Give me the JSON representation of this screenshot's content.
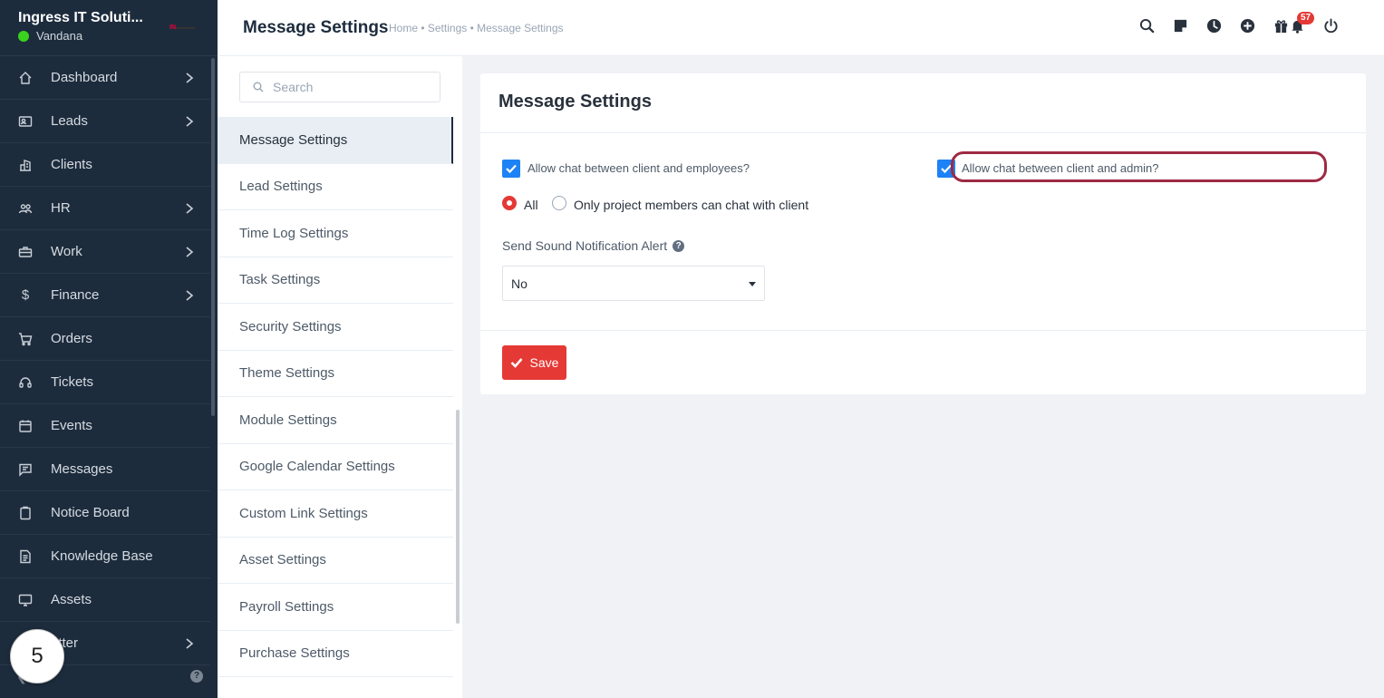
{
  "sidebar": {
    "company": "Ingress IT Soluti...",
    "user": "Vandana",
    "logo_text": "IN",
    "items": [
      {
        "label": "Dashboard",
        "icon": "home-icon",
        "has_submenu": true
      },
      {
        "label": "Leads",
        "icon": "id-card-icon",
        "has_submenu": true
      },
      {
        "label": "Clients",
        "icon": "building-icon",
        "has_submenu": false
      },
      {
        "label": "HR",
        "icon": "people-icon",
        "has_submenu": true
      },
      {
        "label": "Work",
        "icon": "briefcase-icon",
        "has_submenu": true
      },
      {
        "label": "Finance",
        "icon": "dollar-icon",
        "has_submenu": true
      },
      {
        "label": "Orders",
        "icon": "cart-icon",
        "has_submenu": false
      },
      {
        "label": "Tickets",
        "icon": "headset-icon",
        "has_submenu": false
      },
      {
        "label": "Events",
        "icon": "calendar-icon",
        "has_submenu": false
      },
      {
        "label": "Messages",
        "icon": "chat-icon",
        "has_submenu": false
      },
      {
        "label": "Notice Board",
        "icon": "clipboard-icon",
        "has_submenu": false
      },
      {
        "label": "Knowledge Base",
        "icon": "document-icon",
        "has_submenu": false
      },
      {
        "label": "Assets",
        "icon": "monitor-icon",
        "has_submenu": false
      },
      {
        "label": "etter",
        "icon": "letter-icon",
        "has_submenu": true
      }
    ],
    "step_badge": "5"
  },
  "header": {
    "title": "Message Settings",
    "breadcrumb": "Home • Settings • Message Settings",
    "notification_count": "57"
  },
  "settings_menu": {
    "search_placeholder": "Search",
    "items": [
      "Message Settings",
      "Lead Settings",
      "Time Log Settings",
      "Task Settings",
      "Security Settings",
      "Theme Settings",
      "Module Settings",
      "Google Calendar Settings",
      "Custom Link Settings",
      "Asset Settings",
      "Payroll Settings",
      "Purchase Settings"
    ],
    "active_index": 0
  },
  "form": {
    "card_title": "Message Settings",
    "chat_employees_label": "Allow chat between client and employees?",
    "chat_employees_checked": true,
    "chat_admin_label": "Allow chat between client and admin?",
    "chat_admin_checked": true,
    "radio_all_label": "All",
    "radio_members_label": "Only project members can chat with client",
    "radio_selected": "All",
    "sound_label": "Send Sound Notification Alert",
    "sound_value": "No",
    "save_label": "Save"
  },
  "colors": {
    "sidebar_bg": "#1d2c3d",
    "accent_blue": "#1d82f5",
    "danger_red": "#e53935",
    "highlight": "#9e2a44",
    "online": "#39d31e"
  }
}
